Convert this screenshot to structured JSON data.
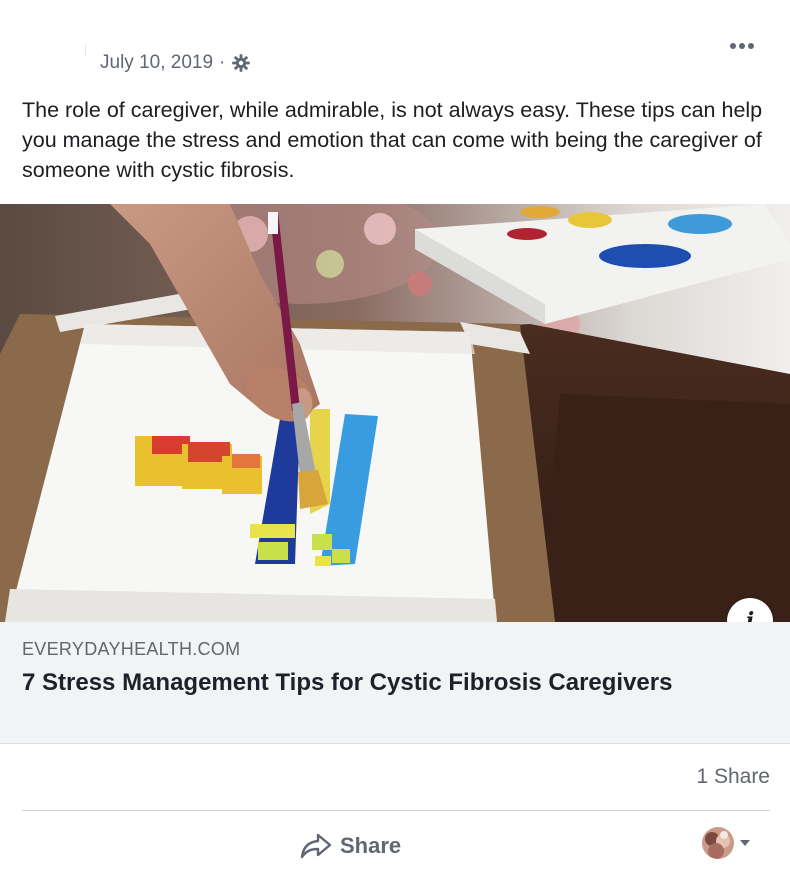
{
  "post": {
    "date": "July 10, 2019",
    "separator": "·",
    "privacy_icon": "gear-icon",
    "more_icon": "more-options-icon",
    "message": "The role of caregiver, while admirable, is not always easy. These tips can help you manage the stress and emotion that can come with being the caregiver of someone with cystic fibrosis."
  },
  "link": {
    "domain": "EVERYDAYHEALTH.COM",
    "title": "7 Stress Management Tips for Cystic Fibrosis Caregivers",
    "info_label": "i",
    "image_subject": "hand painting colorful strokes with a brush on paper"
  },
  "footer": {
    "share_count": "1 Share",
    "share_label": "Share",
    "share_icon": "share-arrow-icon",
    "reaction_avatar": "profile-avatar",
    "caret_icon": "caret-down-icon"
  },
  "colors": {
    "text_primary": "#1c1e21",
    "text_secondary": "#606770",
    "caption_bg": "#f2f3f5",
    "divider": "#ced0d4"
  }
}
